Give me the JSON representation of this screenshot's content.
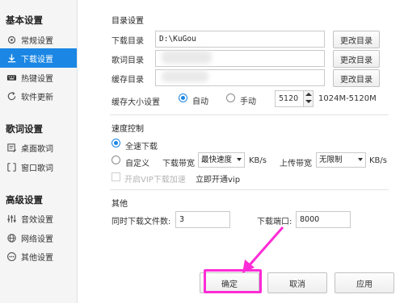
{
  "sidebar": {
    "sections": [
      {
        "title": "基本设置",
        "items": [
          {
            "label": "常规设置",
            "icon": "gear-icon"
          },
          {
            "label": "下载设置",
            "icon": "download-icon",
            "active": true
          },
          {
            "label": "热键设置",
            "icon": "keyboard-icon"
          },
          {
            "label": "软件更新",
            "icon": "update-icon"
          }
        ]
      },
      {
        "title": "歌词设置",
        "items": [
          {
            "label": "桌面歌词",
            "icon": "desktop-lyrics-icon"
          },
          {
            "label": "窗口歌词",
            "icon": "window-lyrics-icon"
          }
        ]
      },
      {
        "title": "高级设置",
        "items": [
          {
            "label": "音效设置",
            "icon": "equalizer-icon"
          },
          {
            "label": "网络设置",
            "icon": "globe-icon"
          },
          {
            "label": "其他设置",
            "icon": "more-icon"
          }
        ]
      }
    ]
  },
  "directory": {
    "title": "目录设置",
    "download_label": "下载目录",
    "download_value": "D:\\KuGou",
    "lyrics_label": "歌词目录",
    "cache_label": "缓存目录",
    "change_button": "更改目录",
    "cache_size_label": "缓存大小设置",
    "auto_label": "自动",
    "manual_label": "手动",
    "cache_value": "5120",
    "cache_range": "1024M-5120M"
  },
  "speed": {
    "title": "速度控制",
    "full_label": "全速下载",
    "custom_label": "自定义",
    "download_bw_label": "下载带宽",
    "download_bw_value": "最快速度",
    "unit1": "KB/s",
    "upload_bw_label": "上传带宽",
    "upload_bw_value": "无限制",
    "unit2": "KB/s",
    "vip_label": "开启VIP下载加速",
    "vip_link": "立即开通vip"
  },
  "other": {
    "title": "其他",
    "concurrent_label": "同时下载文件数:",
    "concurrent_value": "3",
    "port_label": "下载端口:",
    "port_value": "8000"
  },
  "footer": {
    "ok": "确定",
    "cancel": "取消",
    "apply": "应用"
  },
  "colors": {
    "accent": "#1b86e4",
    "highlight": "#ff2bd6"
  }
}
